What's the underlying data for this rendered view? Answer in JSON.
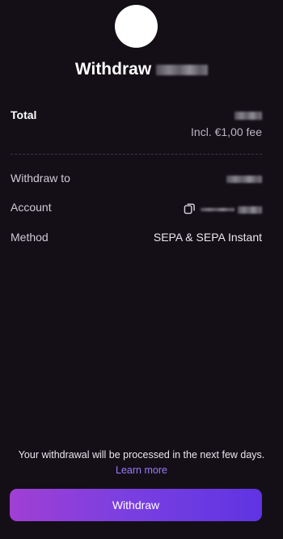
{
  "header": {
    "title": "Withdraw"
  },
  "summary": {
    "total_label": "Total",
    "fee_note": "Incl. €1,00 fee"
  },
  "details": {
    "withdraw_to_label": "Withdraw to",
    "account_label": "Account",
    "method_label": "Method",
    "method_value": "SEPA & SEPA Instant"
  },
  "icons": {
    "copy": "copy-icon"
  },
  "footer": {
    "notice_text": "Your withdrawal will be processed in the next few days.",
    "learn_more": "Learn more",
    "withdraw_button": "Withdraw"
  },
  "colors": {
    "background": "#140f17",
    "accent_link": "#9b7bff",
    "button_gradient_start": "#a03fd4",
    "button_gradient_end": "#5f34e3"
  }
}
